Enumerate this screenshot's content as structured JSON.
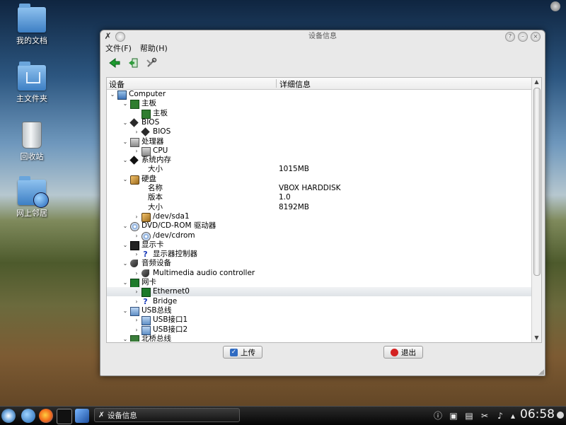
{
  "desktop": {
    "icons": [
      {
        "label": "我的文档"
      },
      {
        "label": "主文件夹"
      },
      {
        "label": "回收站"
      },
      {
        "label": "网上邻居"
      }
    ]
  },
  "window": {
    "title": "设备信息",
    "menu": [
      "文件(F)",
      "帮助(H)"
    ],
    "toolbar_icons": [
      "back-arrow-icon",
      "exit-door-icon",
      "settings-tool-icon"
    ],
    "columns": [
      "设备",
      "详细信息"
    ],
    "rows": [
      {
        "depth": 0,
        "exp": "v",
        "icon": "computer-icon",
        "label": "Computer",
        "value": ""
      },
      {
        "depth": 1,
        "exp": "v",
        "icon": "motherboard-icon",
        "label": "主板",
        "value": ""
      },
      {
        "depth": 2,
        "exp": "",
        "icon": "motherboard-icon",
        "label": "主板",
        "value": ""
      },
      {
        "depth": 1,
        "exp": "v",
        "icon": "chip-icon",
        "label": "BIOS",
        "value": ""
      },
      {
        "depth": 2,
        "exp": ">",
        "icon": "chip-icon",
        "label": "BIOS",
        "value": ""
      },
      {
        "depth": 1,
        "exp": "v",
        "icon": "cpu-icon",
        "label": "处理器",
        "value": ""
      },
      {
        "depth": 2,
        "exp": ">",
        "icon": "cpu-icon",
        "label": "CPU",
        "value": ""
      },
      {
        "depth": 1,
        "exp": "v",
        "icon": "memory-icon",
        "label": "系统内存",
        "value": ""
      },
      {
        "depth": 2,
        "exp": "",
        "icon": "",
        "label": "大小",
        "value": "1015MB"
      },
      {
        "depth": 1,
        "exp": "v",
        "icon": "harddisk-icon",
        "label": "硬盘",
        "value": ""
      },
      {
        "depth": 2,
        "exp": "",
        "icon": "",
        "label": "名称",
        "value": "VBOX HARDDISK"
      },
      {
        "depth": 2,
        "exp": "",
        "icon": "",
        "label": "版本",
        "value": "1.0"
      },
      {
        "depth": 2,
        "exp": "",
        "icon": "",
        "label": "大小",
        "value": "8192MB"
      },
      {
        "depth": 2,
        "exp": ">",
        "icon": "harddisk-icon",
        "label": "/dev/sda1",
        "value": ""
      },
      {
        "depth": 1,
        "exp": "v",
        "icon": "cdrom-icon",
        "label": "DVD/CD-ROM 驱动器",
        "value": ""
      },
      {
        "depth": 2,
        "exp": ">",
        "icon": "cdrom-icon",
        "label": "/dev/cdrom",
        "value": ""
      },
      {
        "depth": 1,
        "exp": "v",
        "icon": "display-icon",
        "label": "显示卡",
        "value": ""
      },
      {
        "depth": 2,
        "exp": ">",
        "icon": "question-icon",
        "label": "显示器控制器",
        "value": ""
      },
      {
        "depth": 1,
        "exp": "v",
        "icon": "audio-icon",
        "label": "音频设备",
        "value": ""
      },
      {
        "depth": 2,
        "exp": ">",
        "icon": "audio-icon",
        "label": "Multimedia audio controller",
        "value": ""
      },
      {
        "depth": 1,
        "exp": "v",
        "icon": "network-card-icon",
        "label": "网卡",
        "value": ""
      },
      {
        "depth": 2,
        "exp": ">",
        "icon": "network-card-icon",
        "label": "Ethernet0",
        "value": "",
        "selected": true
      },
      {
        "depth": 2,
        "exp": ">",
        "icon": "question-icon",
        "label": "Bridge",
        "value": ""
      },
      {
        "depth": 1,
        "exp": "v",
        "icon": "usb-icon",
        "label": "USB总线",
        "value": ""
      },
      {
        "depth": 2,
        "exp": ">",
        "icon": "usb-icon",
        "label": "USB接口1",
        "value": ""
      },
      {
        "depth": 2,
        "exp": ">",
        "icon": "usb-icon",
        "label": "USB接口2",
        "value": ""
      },
      {
        "depth": 1,
        "exp": "v",
        "icon": "chipset-icon",
        "label": "北桥总线",
        "value": ""
      }
    ],
    "buttons": {
      "upload": "上传",
      "exit": "退出"
    }
  },
  "taskbar": {
    "task_title": "设备信息",
    "clock": "06:58"
  },
  "colors": {
    "selection": "#dfe3e7",
    "exit_icon": "#d32222",
    "upload_icon": "#2f6bc2"
  }
}
